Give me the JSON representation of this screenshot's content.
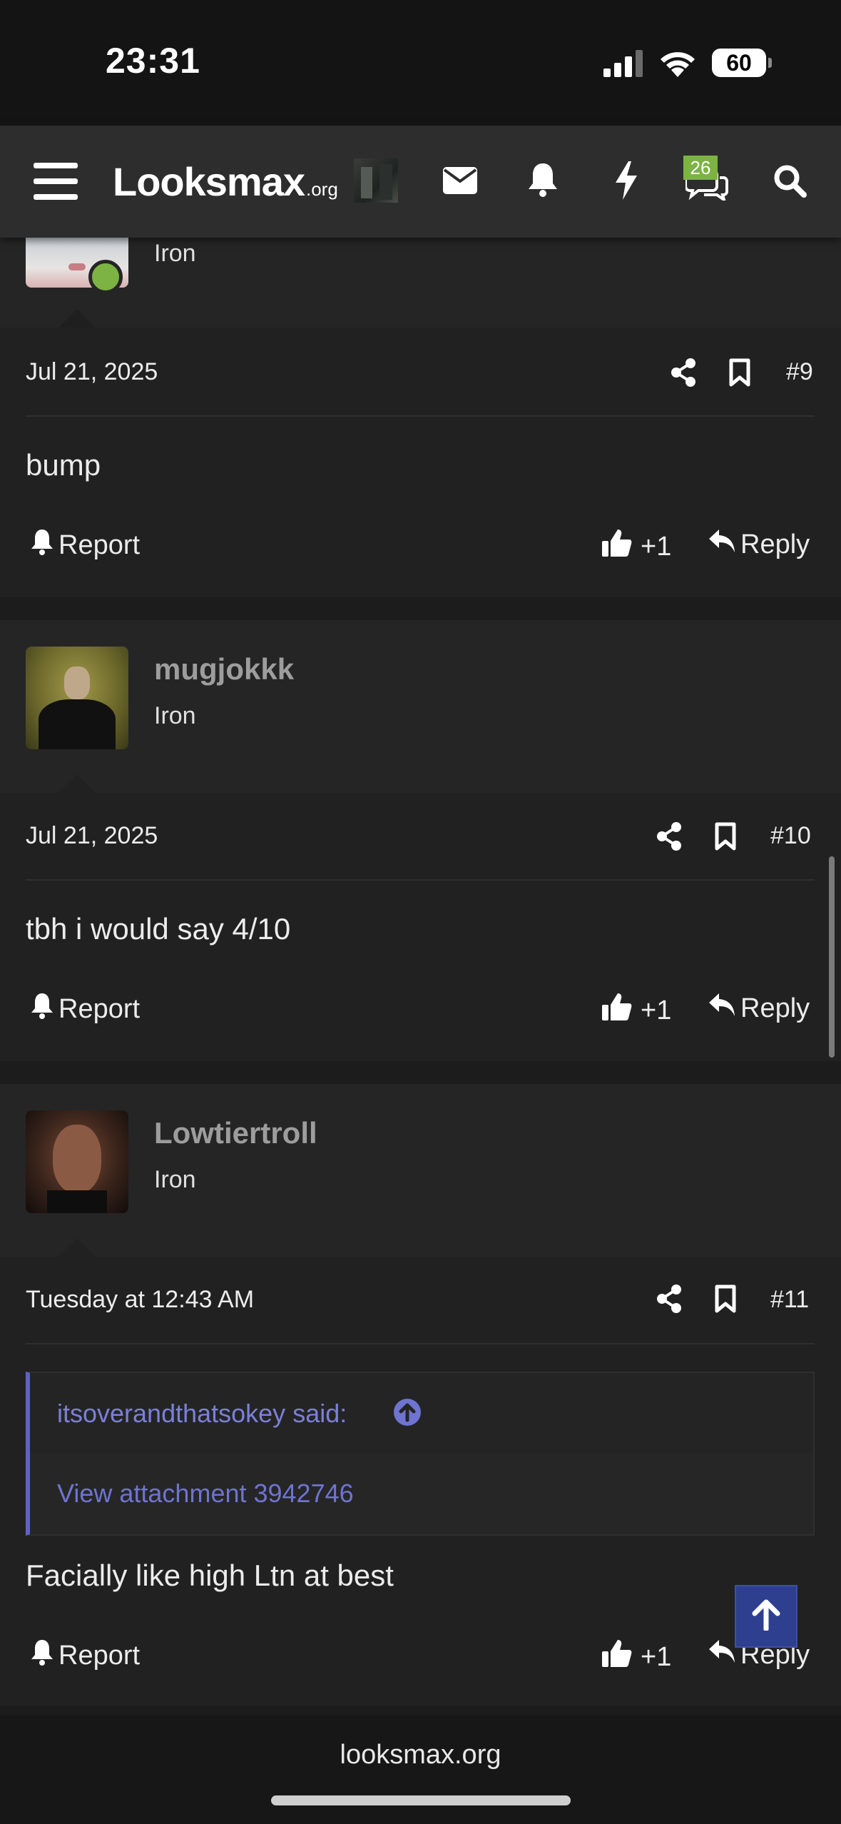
{
  "status_bar": {
    "time": "23:31",
    "battery": "60"
  },
  "nav": {
    "logo_main": "Looksmax",
    "logo_suffix": ".org",
    "conversations_badge": "26",
    "icons": [
      "menu-icon",
      "avatar-thumbnail",
      "envelope-icon",
      "bell-icon",
      "bolt-icon",
      "chat-icon",
      "search-icon"
    ]
  },
  "posts": [
    {
      "rank": "Iron",
      "date": "Jul 21, 2025",
      "number": "#9",
      "body": "bump",
      "report_label": "Report",
      "like_label": "+1",
      "reply_label": "Reply",
      "online": true
    },
    {
      "username": "mugjokkk",
      "rank": "Iron",
      "date": "Jul 21, 2025",
      "number": "#10",
      "body": "tbh i would say 4/10",
      "report_label": "Report",
      "like_label": "+1",
      "reply_label": "Reply"
    },
    {
      "username": "Lowtiertroll",
      "rank": "Iron",
      "date": "Tuesday at 12:43 AM",
      "number": "#11",
      "quote": {
        "author_said": "itsoverandthatsokey said:",
        "attachment": "View attachment 3942746"
      },
      "body": "Facially like high Ltn at best",
      "report_label": "Report",
      "like_label": "+1",
      "reply_label": "Reply"
    }
  ],
  "footer": {
    "domain": "looksmax.org"
  },
  "colors": {
    "background": "#232323",
    "navbar": "#2d2d2d",
    "badge": "#7cb342",
    "quote_accent": "#5c63c6",
    "online_dot": "#7cb342",
    "scroll_top_button": "#2f3f8f"
  }
}
